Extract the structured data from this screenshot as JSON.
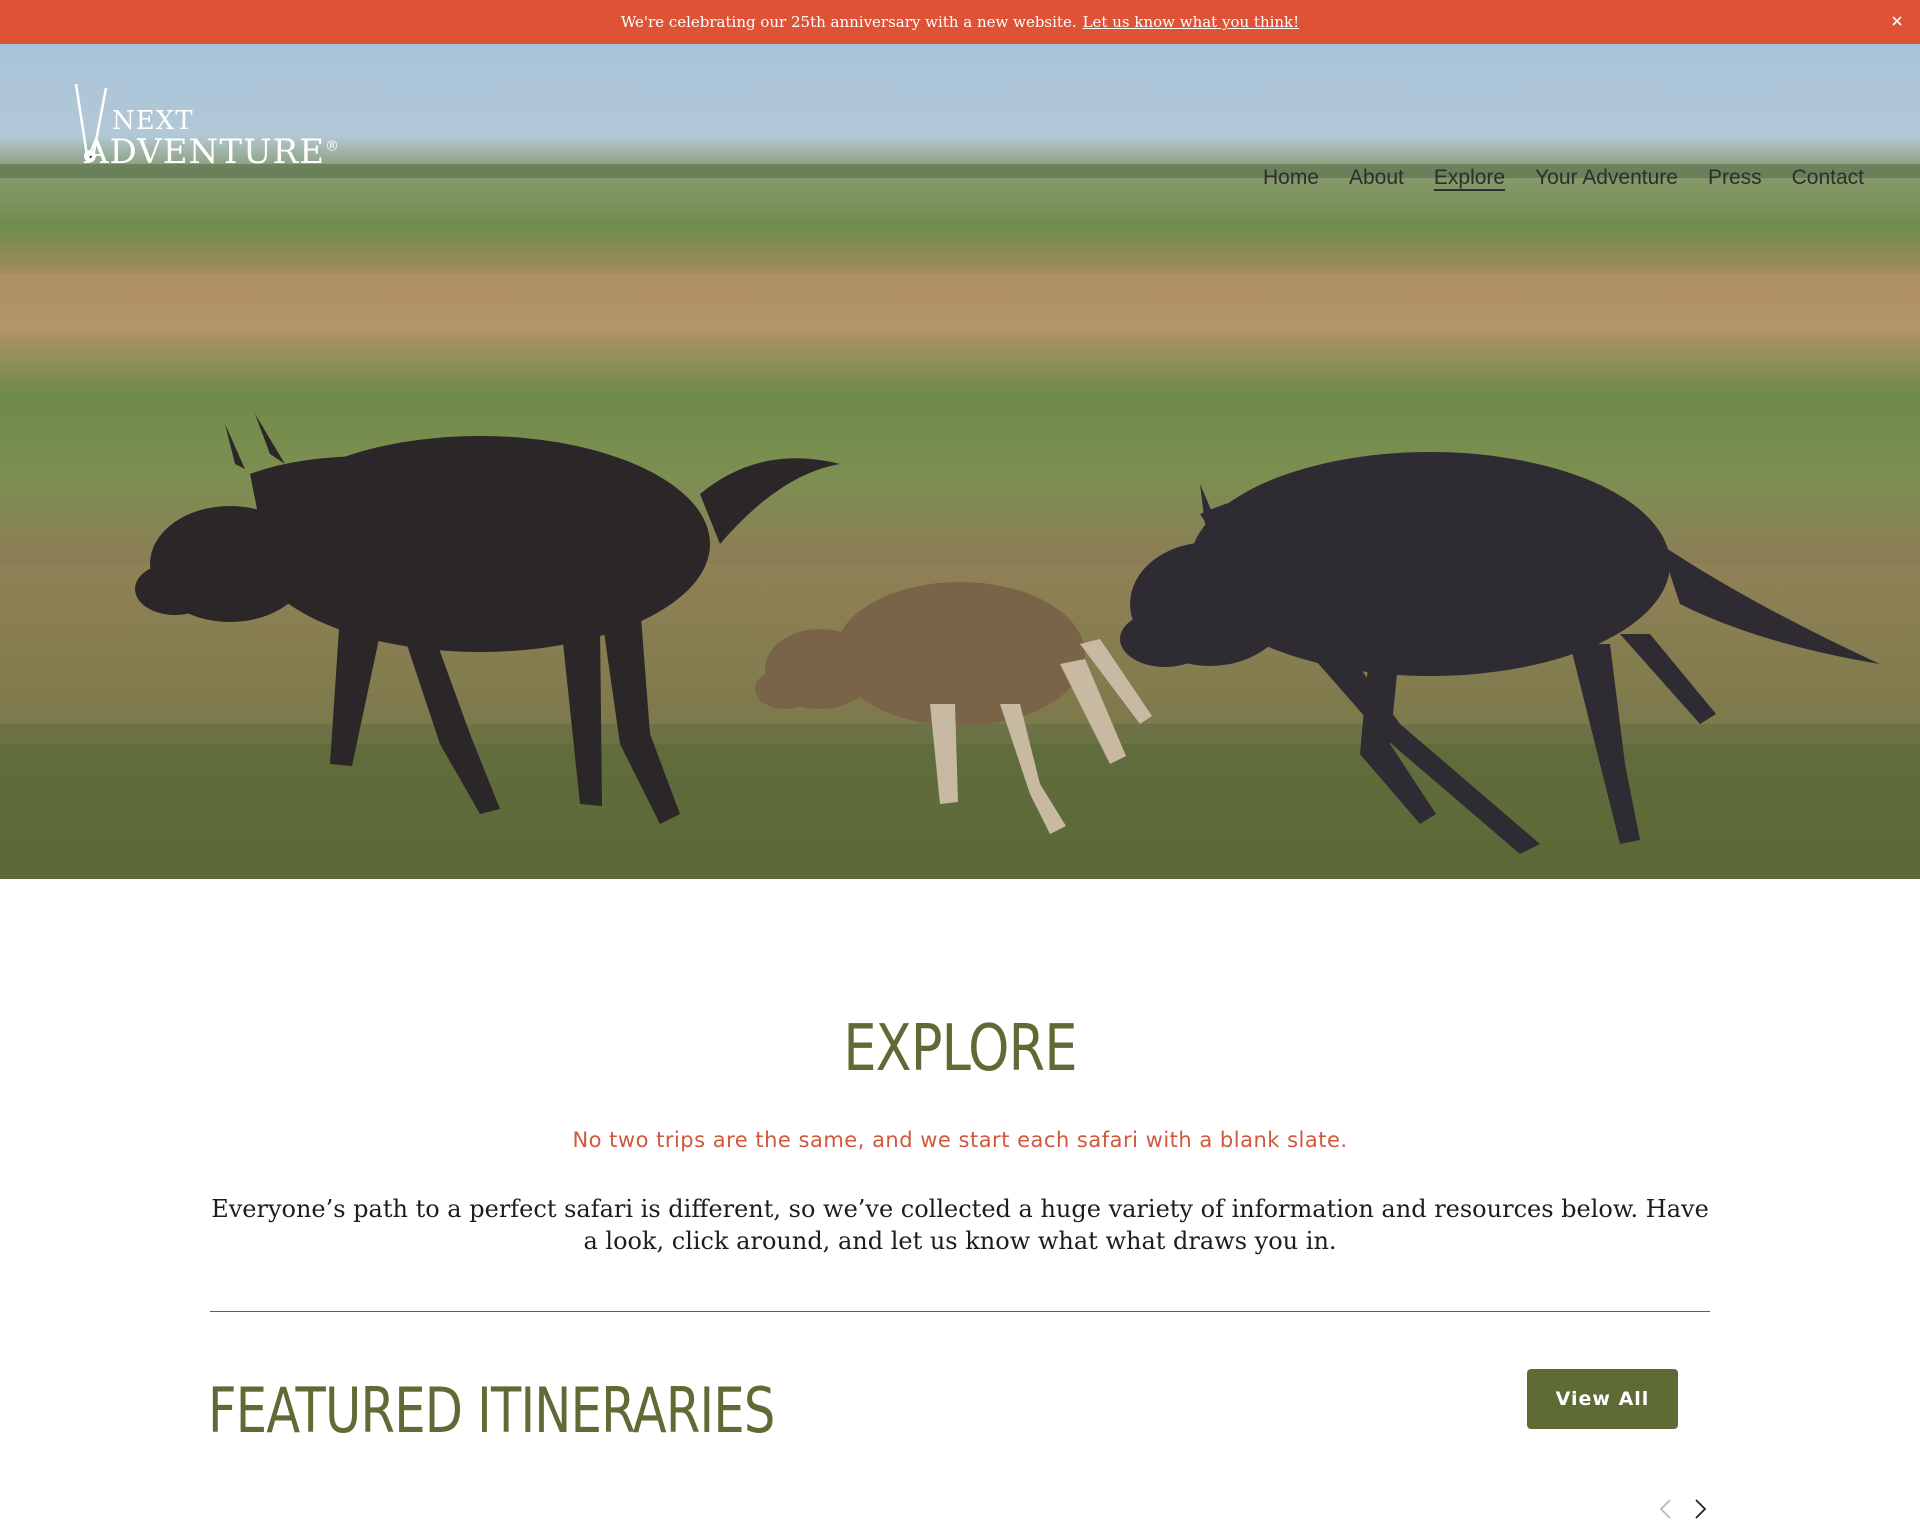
{
  "announcement": {
    "message": "We're celebrating our 25th anniversary with a new website.",
    "link": "Let us know what you think!",
    "close_icon": "close-icon"
  },
  "header": {
    "logo": {
      "line1": "NEXT",
      "line2": "ADVENTURE",
      "mark": "®"
    },
    "nav": [
      {
        "label": "Home"
      },
      {
        "label": "About"
      },
      {
        "label": "Explore",
        "active": true
      },
      {
        "label": "Your Adventure"
      },
      {
        "label": "Press"
      },
      {
        "label": "Contact"
      }
    ]
  },
  "hero": {
    "image_alt_icon": "wildebeest-photo"
  },
  "main": {
    "title": "EXPLORE",
    "lead": "No two trips are the same, and we start each safari with a blank slate.",
    "body": "Everyone’s path to a perfect safari is different, so we’ve collected a huge variety of information and resources below. Have a look, click around, and let us know what what draws you in.",
    "featured_title": "FEATURED ITINERARIES",
    "view_all": "View All",
    "prev_icon": "chevron-left-icon",
    "next_icon": "chevron-right-icon"
  },
  "colors": {
    "announcement_bg": "#de5336",
    "brand_green": "#5f6b34",
    "lead_red": "#d0583d"
  }
}
